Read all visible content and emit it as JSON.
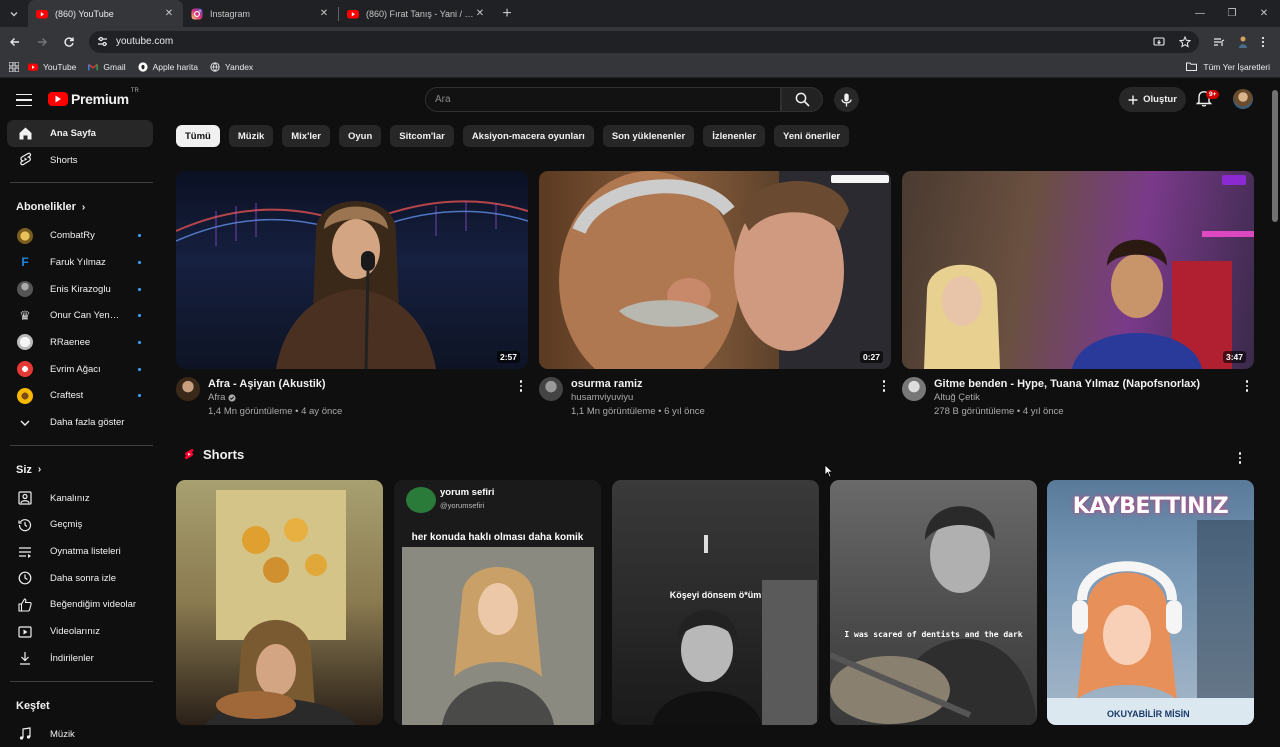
{
  "browser": {
    "tabs": [
      {
        "title": "(860) YouTube",
        "icon": "youtube-icon"
      },
      {
        "title": "Instagram",
        "icon": "instagram-icon"
      },
      {
        "title": "(860) Fırat Tanış - Yani / Lyric (C",
        "icon": "youtube-icon"
      }
    ],
    "url": "youtube.com",
    "bookmarks": [
      "YouTube",
      "Gmail",
      "Apple harita",
      "Yandex"
    ],
    "all_bookmarks": "Tüm Yer İşaretleri"
  },
  "masthead": {
    "brand": "Premium",
    "country": "TR",
    "search_placeholder": "Ara",
    "create_label": "Oluştur",
    "notif_badge": "9+"
  },
  "sidebar": {
    "main": [
      {
        "label": "Ana Sayfa",
        "icon": "home-icon"
      },
      {
        "label": "Shorts",
        "icon": "shorts-icon"
      }
    ],
    "subs_title": "Abonelikler",
    "subs": [
      {
        "label": "CombatRy",
        "color": "#c9a227"
      },
      {
        "label": "Faruk Yılmaz",
        "color": "#1e88e5"
      },
      {
        "label": "Enis Kirazoglu",
        "color": "#555555"
      },
      {
        "label": "Onur Can Yenilm...",
        "color": "#444444"
      },
      {
        "label": "RRaenee",
        "color": "#dddddd"
      },
      {
        "label": "Evrim Ağacı",
        "color": "#e53935"
      },
      {
        "label": "Craftest",
        "color": "#f5b700"
      }
    ],
    "more_label": "Daha fazla göster",
    "you_title": "Siz",
    "you": [
      {
        "label": "Kanalınız",
        "icon": "user-icon"
      },
      {
        "label": "Geçmiş",
        "icon": "history-icon"
      },
      {
        "label": "Oynatma listeleri",
        "icon": "playlist-icon"
      },
      {
        "label": "Daha sonra izle",
        "icon": "clock-icon"
      },
      {
        "label": "Beğendiğim videolar",
        "icon": "like-icon"
      },
      {
        "label": "Videolarınız",
        "icon": "video-icon"
      },
      {
        "label": "İndirilenler",
        "icon": "download-icon"
      }
    ],
    "explore_title": "Keşfet",
    "explore": [
      {
        "label": "Müzik",
        "icon": "music-icon"
      }
    ]
  },
  "chips": [
    "Tümü",
    "Müzik",
    "Mix'ler",
    "Oyun",
    "Sitcom'lar",
    "Aksiyon-macera oyunları",
    "Son yüklenenler",
    "İzlenenler",
    "Yeni öneriler"
  ],
  "videos": [
    {
      "title": "Afra - Aşiyan (Akustik)",
      "channel": "Afra",
      "stats": "1,4 Mn görüntüleme • 4 ay önce",
      "duration": "2:57"
    },
    {
      "title": "osurma ramiz",
      "channel": "husamviyuviyu",
      "stats": "1,1 Mn görüntüleme • 6 yıl önce",
      "duration": "0:27"
    },
    {
      "title": "Gitme benden - Hype, Tuana Yılmaz (Napofsnorlax)",
      "channel": "Altuğ Çetik",
      "stats": "278 B görüntüleme • 4 yıl önce",
      "duration": "3:47"
    }
  ],
  "shorts": {
    "title": "Shorts",
    "items": [
      {
        "text": ""
      },
      {
        "text": "her konuda haklı olması daha komik",
        "header": "yorum sefiri",
        "handle": "@yorumsefiri"
      },
      {
        "text": "Köşeyi dönsem ö*üm"
      },
      {
        "text": "I was scared of dentists and the dark"
      },
      {
        "text": "KAYBETTINIZ",
        "bottom": "OKUYABİLİR MİSİN"
      }
    ]
  }
}
